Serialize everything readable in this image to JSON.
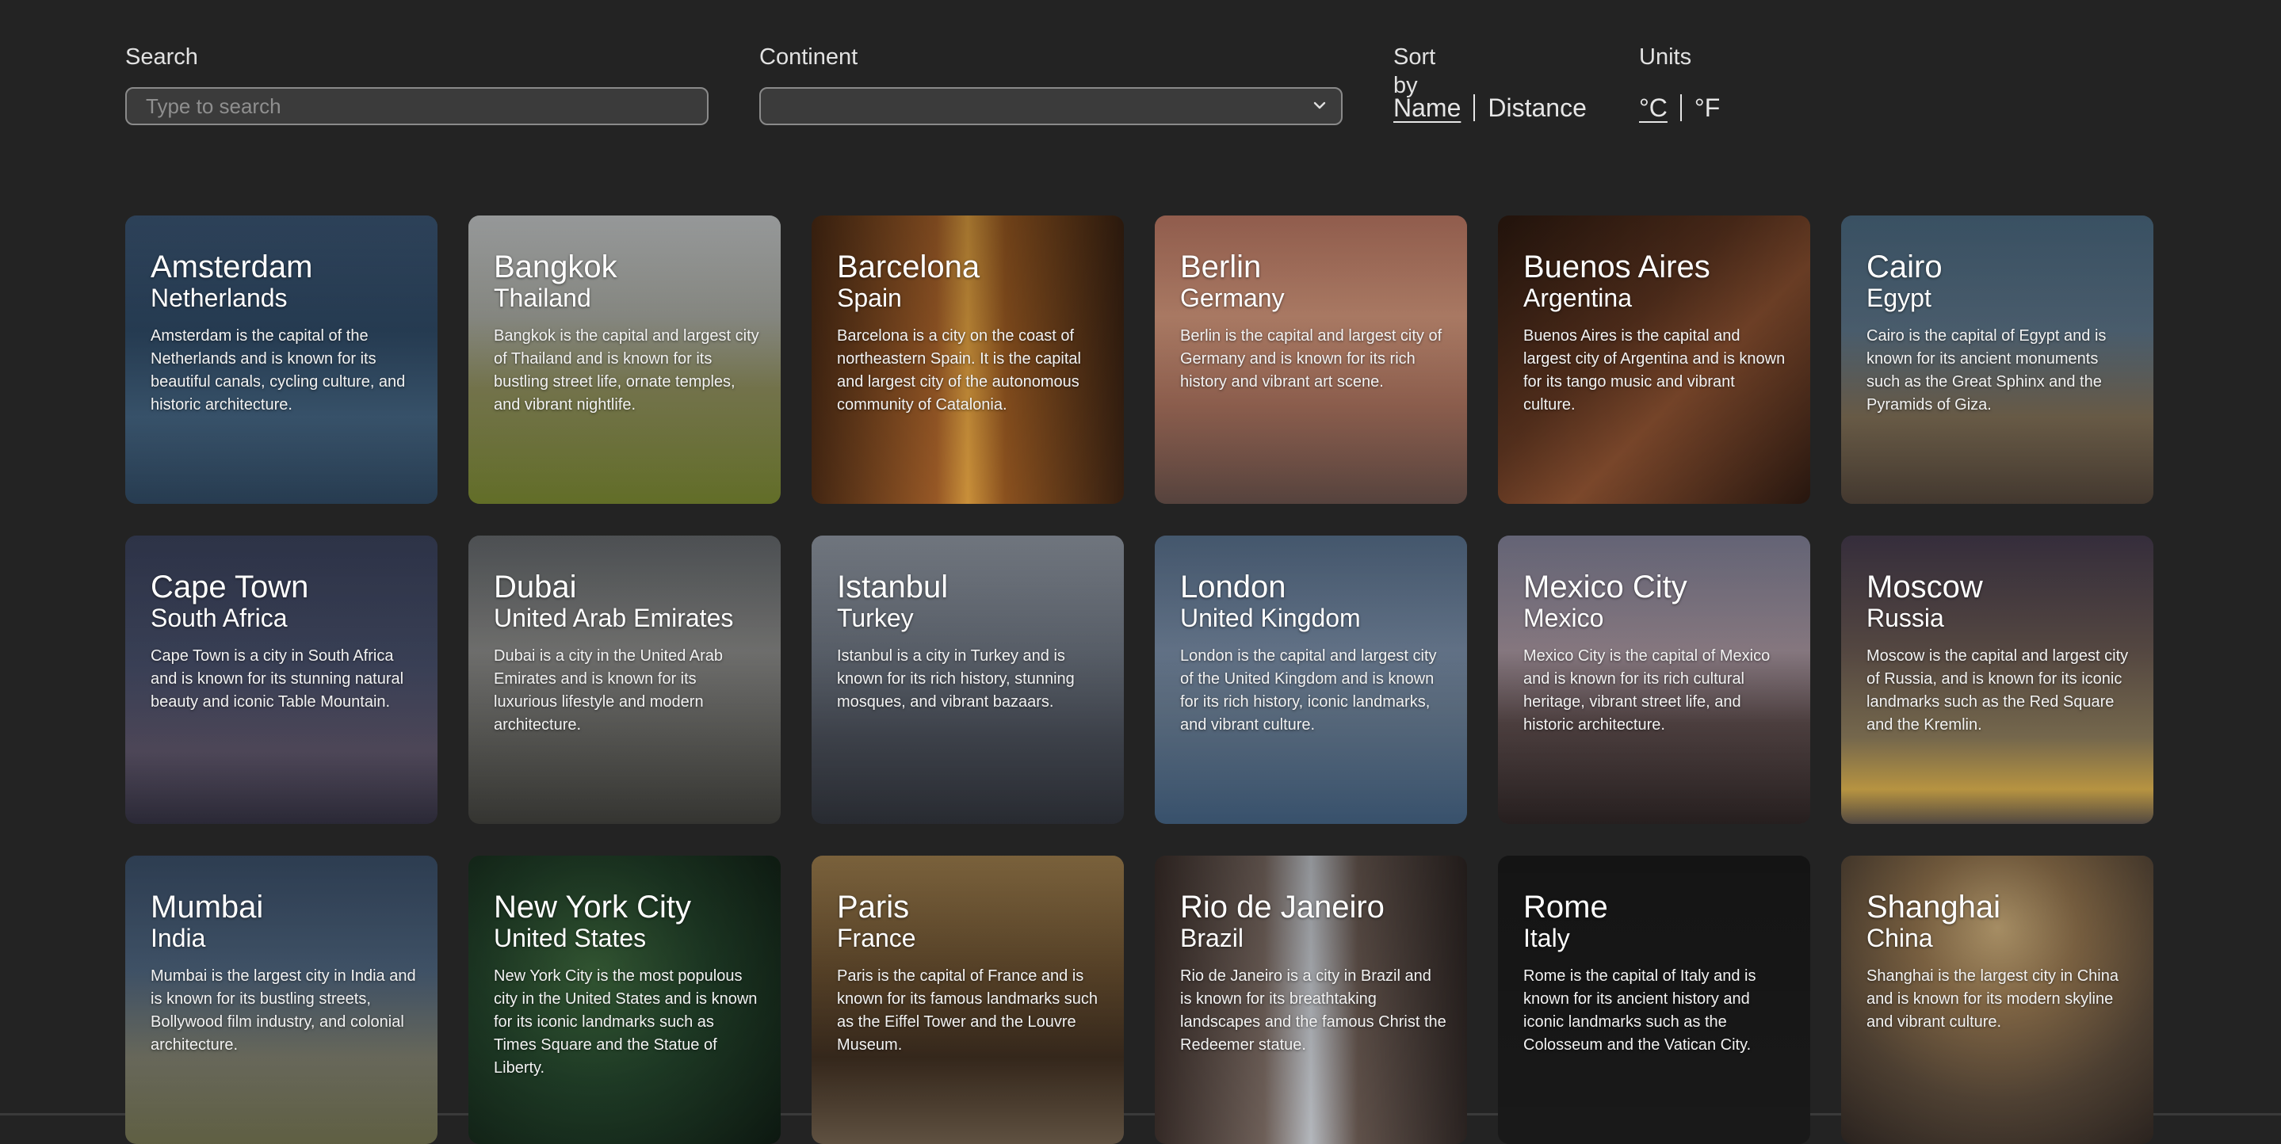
{
  "filters": {
    "search": {
      "label": "Search",
      "placeholder": "Type to search",
      "value": ""
    },
    "continent": {
      "label": "Continent",
      "value": ""
    },
    "sort": {
      "label": "Sort by",
      "options": [
        "Name",
        "Distance"
      ],
      "selected": "Name"
    },
    "units": {
      "label": "Units",
      "options": [
        "°C",
        "°F"
      ],
      "selected": "°C"
    }
  },
  "cities": [
    {
      "city": "Amsterdam",
      "country": "Netherlands",
      "desc": "Amsterdam is the capital of the Netherlands and is known for its beautiful canals, cycling culture, and historic architecture.",
      "bg": "linear-gradient(180deg,#3e5a7a 0%,#2f4a66 40%,#41607c 70%,#2b4259 100%)"
    },
    {
      "city": "Bangkok",
      "country": "Thailand",
      "desc": "Bangkok is the capital and largest city of Thailand and is known for its bustling street life, ornate temples, and vibrant nightlife.",
      "bg": "linear-gradient(180deg,#cfd2d3 0%,#a9aba3 35%,#8a8a5a 60%,#6d7a2c 100%)"
    },
    {
      "city": "Barcelona",
      "country": "Spain",
      "desc": "Barcelona is a city on the coast of northeastern Spain. It is the capital and largest city of the autonomous community of Catalonia.",
      "bg": "linear-gradient(90deg,#4a2a14 0%,#a8622a 40%,#e0a040 50%,#9a5a22 62%,#3a2212 100%)"
    },
    {
      "city": "Berlin",
      "country": "Germany",
      "desc": "Berlin is the capital and largest city of Germany and is known for its rich history and vibrant art scene.",
      "bg": "linear-gradient(180deg,#c8806a 0%,#d79a7e 35%,#a7705c 65%,#5f4a44 100%)"
    },
    {
      "city": "Buenos Aires",
      "country": "Argentina",
      "desc": "Buenos Aires is the capital and largest city of Argentina and is known for its tango music and vibrant culture.",
      "bg": "linear-gradient(135deg,#2e1a10 0%,#5e3520 40%,#8a5030 60%,#2a1810 100%)"
    },
    {
      "city": "Cairo",
      "country": "Egypt",
      "desc": "Cairo is the capital of Egypt and is known for its ancient monuments such as the Great Sphinx and the Pyramids of Giza.",
      "bg": "linear-gradient(180deg,#4f6f88 0%,#5c7488 40%,#7a6a52 70%,#4a3e34 100%)"
    },
    {
      "city": "Cape Town",
      "country": "South Africa",
      "desc": "Cape Town is a city in South Africa and is known for its stunning natural beauty and iconic Table Mountain.",
      "bg": "linear-gradient(180deg,#3e4662 0%,#474f6a 45%,#5a5266 75%,#2f2d3c 100%)"
    },
    {
      "city": "Dubai",
      "country": "United Arab Emirates",
      "desc": "Dubai is a city in the United Arab Emirates and is known for its luxurious lifestyle and modern architecture.",
      "bg": "linear-gradient(180deg,#6a6e72 0%,#8a8a88 40%,#5a5a56 75%,#3a3a36 100%)"
    },
    {
      "city": "Istanbul",
      "country": "Turkey",
      "desc": "Istanbul is a city in Turkey and is known for its rich history, stunning mosques, and vibrant bazaars.",
      "bg": "linear-gradient(180deg,#9aa2ae 0%,#6e7682 40%,#474c56 70%,#2c2f36 100%)"
    },
    {
      "city": "London",
      "country": "United Kingdom",
      "desc": "London is the capital and largest city of the United Kingdom and is known for its rich history, iconic landmarks, and vibrant culture.",
      "bg": "linear-gradient(180deg,#5e7896 0%,#7a8ea8 40%,#6a7e94 60%,#3e5a78 100%)"
    },
    {
      "city": "Mexico City",
      "country": "Mexico",
      "desc": "Mexico City is the capital of Mexico and is known for its rich cultural heritage, vibrant street life, and historic architecture.",
      "bg": "linear-gradient(180deg,#8a8aa2 0%,#a896a0 40%,#5a4a4a 65%,#2a2222 100%)"
    },
    {
      "city": "Moscow",
      "country": "Russia",
      "desc": "Moscow is the capital and largest city of Russia, and is known for its iconic landmarks such as the Red Square and the Kremlin.",
      "bg": "linear-gradient(180deg,#4a3f52 0%,#6a5a52 40%,#8a7a5a 70%,#d0a84a 88%,#5a5048 100%)"
    },
    {
      "city": "Mumbai",
      "country": "India",
      "desc": "Mumbai is the largest city in India and is known for its bustling streets, Bollywood film industry, and colonial architecture.",
      "bg": "linear-gradient(180deg,#3e5470 0%,#4f6680 40%,#7a7a6a 70%,#6a6a4a 100%)"
    },
    {
      "city": "New York City",
      "country": "United States",
      "desc": "New York City is the most populous city in the United States and is known for its iconic landmarks such as Times Square and the Statue of Liberty.",
      "bg": "radial-gradient(circle at 40% 40%,#3e6a3e 0%,#22422a 45%,#0e1a12 100%)"
    },
    {
      "city": "Paris",
      "country": "France",
      "desc": "Paris is the capital of France and is known for its famous landmarks such as the Eiffel Tower and the Louvre Museum.",
      "bg": "linear-gradient(180deg,#a88652 0%,#6a5030 40%,#3e2e20 70%,#6a5a48 100%)"
    },
    {
      "city": "Rio de Janeiro",
      "country": "Brazil",
      "desc": "Rio de Janeiro is a city in Brazil and is known for its breathtaking landscapes and the famous Christ the Redeemer statue.",
      "bg": "linear-gradient(90deg,#3a2e2a 0%,#7a6a62 35%,#c8ccd2 50%,#6a5a52 65%,#2e2624 100%)"
    },
    {
      "city": "Rome",
      "country": "Italy",
      "desc": "Rome is the capital of Italy and is known for its ancient history and iconic landmarks such as the Colosseum and the Vatican City.",
      "bg": "#1c1c1c"
    },
    {
      "city": "Shanghai",
      "country": "China",
      "desc": "Shanghai is the largest city in China and is known for its modern skyline and vibrant culture.",
      "bg": "radial-gradient(circle at 50% 25%,#d8b882 0%,#9a7a52 30%,#5a4a3a 65%,#2e2622 100%)"
    }
  ]
}
